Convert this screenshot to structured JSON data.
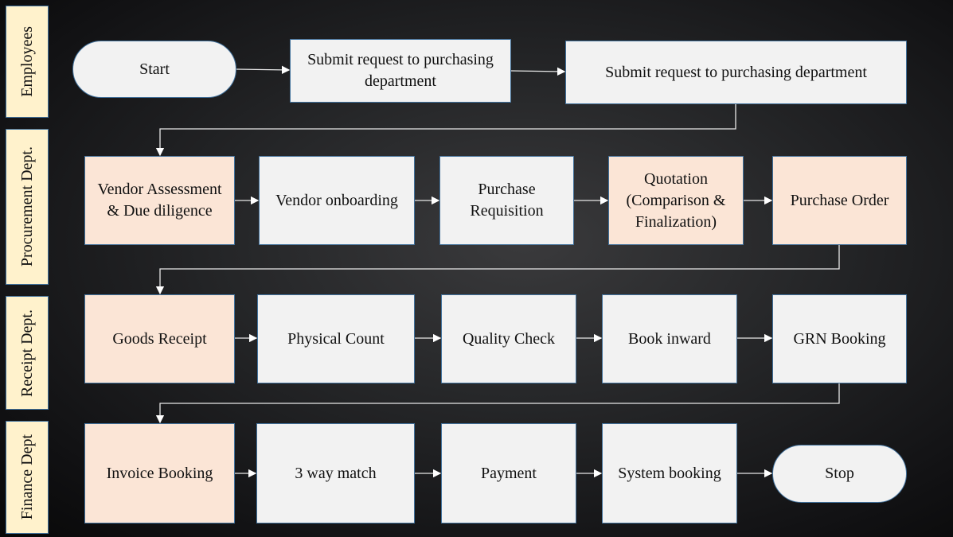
{
  "lanes": [
    "Employees",
    "Procurement Dept.",
    "Receipt Dept.",
    "Finance Dept"
  ],
  "steps": {
    "start": "Start",
    "submit_request_1": "Submit request to purchasing department",
    "submit_request_2": "Submit request to purchasing department",
    "vendor_assessment": "Vendor Assessment & Due diligence",
    "vendor_onboarding": "Vendor onboarding",
    "purchase_requisition": "Purchase Requisition",
    "quotation": "Quotation (Comparison & Finalization)",
    "purchase_order": "Purchase Order",
    "goods_receipt": "Goods Receipt",
    "physical_count": "Physical Count",
    "quality_check": "Quality Check",
    "book_inward": "Book inward",
    "grn_booking": "GRN Booking",
    "invoice_booking": "Invoice Booking",
    "three_way_match": "3 way match",
    "payment": "Payment",
    "system_booking": "System booking",
    "stop": "Stop"
  },
  "colors": {
    "lane": "#fff2cc",
    "highlight": "#fbe5d6",
    "normal": "#f2f2f2",
    "border": "#41719c"
  }
}
